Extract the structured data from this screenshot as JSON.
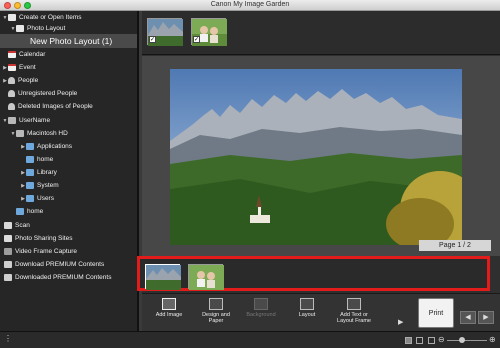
{
  "window": {
    "title": "Canon My Image Garden"
  },
  "sidebar": {
    "items": [
      {
        "label": "Create or Open Items"
      },
      {
        "label": "Photo Layout"
      },
      {
        "label": "New Photo Layout (1)"
      },
      {
        "label": "Calendar"
      },
      {
        "label": "Event"
      },
      {
        "label": "People"
      },
      {
        "label": "Unregistered People"
      },
      {
        "label": "Deleted Images of People"
      },
      {
        "label": "UserName"
      },
      {
        "label": "Macintosh HD"
      },
      {
        "label": "Applications"
      },
      {
        "label": "home"
      },
      {
        "label": "Library"
      },
      {
        "label": "System"
      },
      {
        "label": "Users"
      },
      {
        "label": "home"
      },
      {
        "label": "Scan"
      },
      {
        "label": "Photo Sharing Sites"
      },
      {
        "label": "Video Frame Capture"
      },
      {
        "label": "Download PREMIUM Contents"
      },
      {
        "label": "Downloaded PREMIUM Contents"
      }
    ]
  },
  "preview": {
    "page_indicator": "Page 1 / 2"
  },
  "toolbar": {
    "add_image": "Add Image",
    "design_paper": "Design and Paper",
    "background": "Background",
    "layout": "Layout",
    "add_text_frame": "Add Text or Layout Frame",
    "print": "Print"
  },
  "colors": {
    "highlight_frame": "#e21b1b",
    "selected_item": "#4a4a4a"
  },
  "icons": [
    "gear-icon",
    "zoom-out-icon",
    "zoom-in-icon",
    "prev-page-icon",
    "next-page-icon"
  ]
}
